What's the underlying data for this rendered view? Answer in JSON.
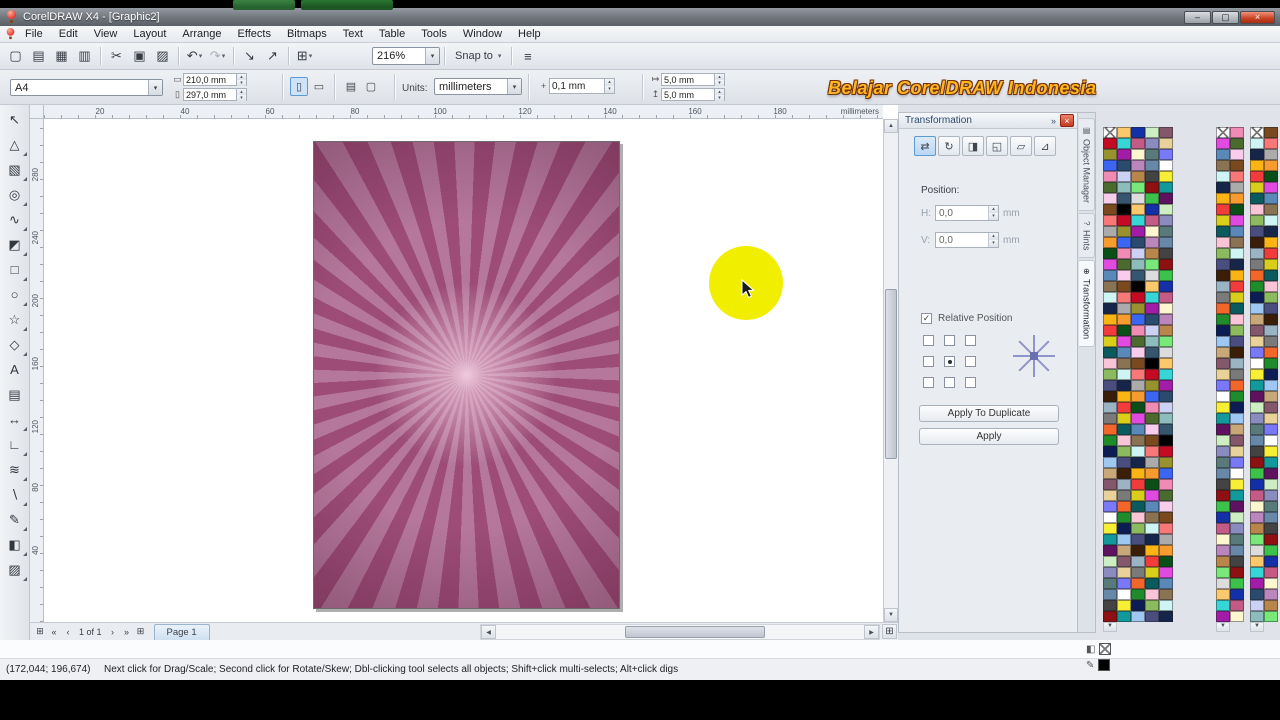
{
  "window": {
    "title": "CorelDRAW X4 - [Graphic2]",
    "buttons": {
      "minimize": "–",
      "maximize": "▢",
      "close": "×"
    }
  },
  "menubar": {
    "items": [
      "File",
      "Edit",
      "View",
      "Layout",
      "Arrange",
      "Effects",
      "Bitmaps",
      "Text",
      "Table",
      "Tools",
      "Window",
      "Help"
    ]
  },
  "toolbar": {
    "buttons": [
      {
        "name": "new-document-button",
        "glyph": "▢"
      },
      {
        "name": "open-button",
        "glyph": "▤"
      },
      {
        "name": "save-button",
        "glyph": "▦"
      },
      {
        "name": "print-button",
        "glyph": "▥"
      },
      {
        "sep": true
      },
      {
        "name": "cut-button",
        "glyph": "✂"
      },
      {
        "name": "copy-button",
        "glyph": "▣"
      },
      {
        "name": "paste-button",
        "glyph": "▨"
      },
      {
        "sep": true
      },
      {
        "name": "undo-button",
        "glyph": "↶",
        "dropdown": true
      },
      {
        "name": "redo-button",
        "glyph": "↷",
        "dropdown": true,
        "disabled": true
      },
      {
        "sep": true
      },
      {
        "name": "import-button",
        "glyph": "↘"
      },
      {
        "name": "export-button",
        "glyph": "↗"
      },
      {
        "sep": true
      },
      {
        "name": "application-launcher-button",
        "glyph": "⊞",
        "dropdown": true
      }
    ],
    "zoom_value": "216%",
    "snap_label": "Snap to",
    "options_glyph": "≡"
  },
  "property_bar": {
    "paper_size": "A4",
    "paper_width": "210,0 mm",
    "paper_height": "297,0 mm",
    "units_label": "Units:",
    "units_value": "millimeters",
    "nudge_value": "0,1 mm",
    "duplicate_h": "5,0 mm",
    "duplicate_v": "5,0 mm",
    "icons": {
      "width": "▭",
      "height": "▯",
      "portrait": "▯",
      "landscape": "▭",
      "all_pages": "▤",
      "current_page": "▢",
      "nudge": "+",
      "dup_h": "↦",
      "dup_v": "↥"
    }
  },
  "watermark": {
    "text": "Belajar CorelDRAW Indonesia",
    "color": "#ffb81e"
  },
  "rulers": {
    "h_labels": [
      "20",
      "40",
      "60",
      "80",
      "100",
      "120",
      "140",
      "160",
      "180"
    ],
    "h_unit": "millimeters",
    "v_labels": [
      "280",
      "240",
      "200",
      "160",
      "120",
      "80",
      "40"
    ]
  },
  "toolbox": {
    "tools": [
      {
        "name": "pick-tool",
        "glyph": "↖",
        "flyout": false
      },
      {
        "name": "shape-tool",
        "glyph": "△",
        "flyout": true
      },
      {
        "name": "crop-tool",
        "glyph": "▧",
        "flyout": true
      },
      {
        "name": "zoom-tool",
        "glyph": "◎",
        "flyout": true
      },
      {
        "name": "freehand-tool",
        "glyph": "∿",
        "flyout": true
      },
      {
        "name": "smart-fill-tool",
        "glyph": "◩",
        "flyout": true
      },
      {
        "name": "rectangle-tool",
        "glyph": "□",
        "flyout": true
      },
      {
        "name": "ellipse-tool",
        "glyph": "○",
        "flyout": true
      },
      {
        "name": "polygon-tool",
        "glyph": "☆",
        "flyout": true
      },
      {
        "name": "basic-shapes-tool",
        "glyph": "◇",
        "flyout": true
      },
      {
        "name": "text-tool",
        "glyph": "A",
        "flyout": false
      },
      {
        "name": "table-tool",
        "glyph": "▤",
        "flyout": false
      },
      {
        "name": "dimension-tool",
        "glyph": "↔",
        "flyout": true
      },
      {
        "name": "connector-tool",
        "glyph": "∟",
        "flyout": true
      },
      {
        "name": "blend-tool",
        "glyph": "≋",
        "flyout": true
      },
      {
        "name": "eyedropper-tool",
        "glyph": "∖",
        "flyout": true
      },
      {
        "name": "outline-pen-tool",
        "glyph": "✎",
        "flyout": true
      },
      {
        "name": "fill-tool",
        "glyph": "◧",
        "flyout": true
      },
      {
        "name": "interactive-fill-tool",
        "glyph": "▨",
        "flyout": true
      }
    ]
  },
  "canvas": {
    "page_color_dark": "#9c4c77",
    "page_color_light": "#b5789c",
    "page_center_glow": "#f0cade",
    "highlight_circle_color": "#f2ee00"
  },
  "docker": {
    "title": "Transformation",
    "chevron": "»",
    "close_glyph": "×",
    "mode_buttons": [
      {
        "name": "transform-position-button",
        "glyph": "⇄",
        "active": true
      },
      {
        "name": "transform-rotate-button",
        "glyph": "↻",
        "active": false
      },
      {
        "name": "transform-scale-mirror-button",
        "glyph": "◨",
        "active": false
      },
      {
        "name": "transform-size-button",
        "glyph": "◱",
        "active": false
      },
      {
        "name": "transform-skew-button",
        "glyph": "▱",
        "active": false
      },
      {
        "name": "transform-anchor-button",
        "glyph": "⊿",
        "active": false
      }
    ],
    "position_label": "Position:",
    "h_label": "H:",
    "h_value": "0,0",
    "h_unit": "mm",
    "v_label": "V:",
    "v_value": "0,0",
    "v_unit": "mm",
    "relative_label": "Relative Position",
    "apply_duplicate_label": "Apply To Duplicate",
    "apply_label": "Apply",
    "tabs": [
      {
        "label": "Object Manager",
        "icon": "▤",
        "active": false
      },
      {
        "label": "Hints",
        "icon": "?",
        "active": false
      },
      {
        "label": "Transformation",
        "icon": "⊕",
        "active": true
      }
    ]
  },
  "page_nav": {
    "count_label": "1 of 1",
    "page_tab": "Page 1",
    "glyphs": {
      "add": "⊞",
      "first": "«",
      "prev": "‹",
      "next": "›",
      "last": "»",
      "add_after": "⊞"
    }
  },
  "status_bar": {
    "coords": "(172,044; 196,674)",
    "message": "Next click for Drag/Scale; Second click for Rotate/Skew; Dbl-clicking tool selects all objects; Shift+click multi-selects; Alt+click digs",
    "fill_glyph": "◧",
    "outline_glyph": "✎",
    "outline_color": "#000000"
  },
  "palettes": {
    "base_colors": [
      "#000000",
      "#434343",
      "#7a7a7a",
      "#ababab",
      "#dcdcdc",
      "#ffffff",
      "#f23b3b",
      "#c40b23",
      "#8e1010",
      "#f2662a",
      "#f79b2e",
      "#fbc96b",
      "#f7ef34",
      "#d9cf1a",
      "#97922e",
      "#3cc24a",
      "#1e8c2a",
      "#0b4f18",
      "#37d6d6",
      "#12999c",
      "#0b5a5e",
      "#3a66f2",
      "#1430a8",
      "#0c1c55",
      "#e14ae1",
      "#a21ca8",
      "#5e1260",
      "#f9c4d6",
      "#f08cb4",
      "#c45a86",
      "#9ec7f2",
      "#5a88b8",
      "#2a4a6e",
      "#cdeec2",
      "#8cba5e",
      "#4a6a2e",
      "#fdf6cf",
      "#c8a878",
      "#8a7352",
      "#ccd2f4",
      "#8a8cc0",
      "#4a4e7e",
      "#f8cdeb",
      "#ba86bc",
      "#84586a",
      "#cff4f4",
      "#8cbcbc",
      "#587a7a",
      "#3a1e08",
      "#7a4a1e",
      "#b8864a",
      "#e8d29a",
      "#16264a",
      "#35566e",
      "#6888a8",
      "#9ab4c4",
      "#f87878",
      "#78e878",
      "#7878f8",
      "#fcb414"
    ],
    "blocks": {
      "a": {
        "cols": 5,
        "rows": 45,
        "offset": 0
      },
      "b": {
        "cols": 2,
        "rows": 45,
        "offset": 17
      },
      "c": {
        "cols": 2,
        "rows": 45,
        "offset": 38
      }
    }
  },
  "ui_glyphs": {
    "combo_arrow": "▾",
    "spin_up": "▴",
    "spin_down": "▾",
    "scroll_up": "▲",
    "scroll_down": "▼",
    "scroll_left": "◀",
    "scroll_right": "▶",
    "check": "✓",
    "navigator": "⊞"
  }
}
